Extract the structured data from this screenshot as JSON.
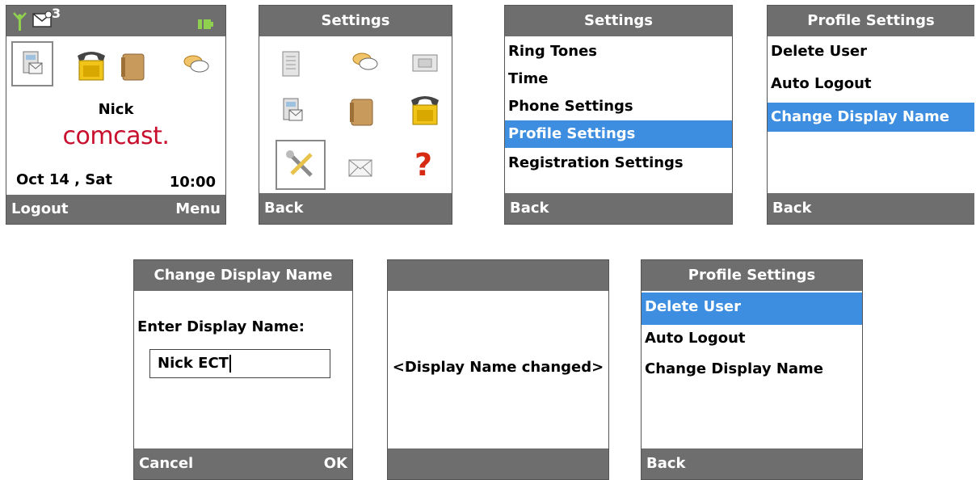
{
  "home": {
    "message_count": "3",
    "user_name": "Nick",
    "brand": "comcast.",
    "date": "Oct 14 , Sat",
    "time": "10:00",
    "soft_left": "Logout",
    "soft_right": "Menu",
    "icons": [
      "directory-icon",
      "phone-icon",
      "notebook-icon",
      "conference-icon"
    ]
  },
  "settings_grid": {
    "title": "Settings",
    "soft_left": "Back",
    "icons": [
      "notepad-icon",
      "conference-icon",
      "display-icon",
      "directory-icon",
      "notebook-icon",
      "phone-icon",
      "tools-icon",
      "mail-icon",
      "help-icon"
    ],
    "selected_icon": "tools-icon"
  },
  "settings_list": {
    "title": "Settings",
    "items": [
      "Ring Tones",
      "Time",
      "Phone Settings",
      "Profile Settings",
      "Registration Settings"
    ],
    "selected_index": 3,
    "soft_left": "Back"
  },
  "profile_settings": {
    "title": "Profile Settings",
    "items": [
      "Delete User",
      "Auto Logout",
      "Change Display Name"
    ],
    "selected_index": 2,
    "soft_left": "Back"
  },
  "change_display_name": {
    "title": "Change Display Name",
    "prompt": "Enter Display Name:",
    "input_value": "Nick ECT",
    "soft_left": "Cancel",
    "soft_right": "OK"
  },
  "confirmation": {
    "title": "",
    "message": "<Display Name changed>"
  },
  "profile_settings_after": {
    "title": "Profile Settings",
    "items": [
      "Delete User",
      "Auto Logout",
      "Change Display Name"
    ],
    "selected_index": 0,
    "soft_left": "Back"
  },
  "colors": {
    "bar": "#6e6e6e",
    "highlight": "#3d8ee0",
    "brand_red": "#c8102e",
    "screen_bg": "#ffffff"
  }
}
